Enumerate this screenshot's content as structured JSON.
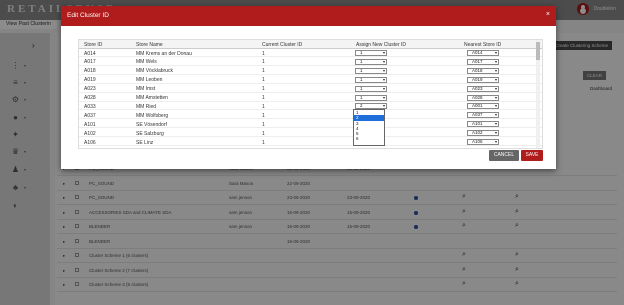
{
  "app": {
    "logo": "RETAILSENSE",
    "breadcrumb": "View Past Clusterin",
    "user": "Doublelon"
  },
  "sidebar": {
    "toggle": "›",
    "icons": [
      "network-icon",
      "layers-icon",
      "settings-icon",
      "user-icon",
      "group-icon",
      "trophy-icon",
      "person-icon",
      "team-icon",
      "globe-icon"
    ]
  },
  "background": {
    "create_button": "Create Clustering Scheme",
    "clear_button": "CLEAR",
    "dashboard_label": "Dashboard",
    "rows": [
      {
        "name": "PC_SOUND",
        "owner": "Sara Mason",
        "date": "22-09-2020",
        "date2": "22-09-2020",
        "dot": false,
        "view": false
      },
      {
        "name": "PC_SOUND",
        "owner": "Sara Mason",
        "date": "22-09-2020",
        "date2": "",
        "dot": false,
        "view": false
      },
      {
        "name": "PC_SOUND",
        "owner": "sam jenson",
        "date": "23-09-2020",
        "date2": "23-09-2020",
        "dot": true,
        "view": true
      },
      {
        "name": "ACCESSORIES SDA and CLIMATE SDA",
        "owner": "sam jenson",
        "date": "15-09-2020",
        "date2": "15-09-2020",
        "dot": true,
        "view": true
      },
      {
        "name": "BLENDER",
        "owner": "sam jenson",
        "date": "15-09-2020",
        "date2": "15-09-2020",
        "dot": true,
        "view": true
      },
      {
        "name": "BLENDER",
        "owner": "",
        "date": "15-09-2020",
        "date2": "",
        "dot": false,
        "view": false
      },
      {
        "name": "Cluster Scheme 1 (6 clusters)",
        "owner": "",
        "date": "",
        "date2": "",
        "dot": false,
        "view": true
      },
      {
        "name": "Cluster Scheme 2 (7 clusters)",
        "owner": "",
        "date": "",
        "date2": "",
        "dot": false,
        "view": true
      },
      {
        "name": "Cluster Scheme 3 (5 clusters)",
        "owner": "",
        "date": "",
        "date2": "",
        "dot": false,
        "view": true
      }
    ]
  },
  "modal": {
    "title": "Edit Cluster ID",
    "close": "×",
    "columns": [
      "Store ID",
      "Store Name",
      "Current Cluster ID",
      "Assign New Cluster ID",
      "Nearest Store ID"
    ],
    "rows": [
      {
        "store_id": "A014",
        "store_name": "MM Krems an der Donau",
        "current": "1",
        "assign": "1",
        "nearest": "A014"
      },
      {
        "store_id": "A017",
        "store_name": "MM Wels",
        "current": "1",
        "assign": "1",
        "nearest": "A017"
      },
      {
        "store_id": "A018",
        "store_name": "MM Vöcklabruck",
        "current": "1",
        "assign": "1",
        "nearest": "A018"
      },
      {
        "store_id": "A019",
        "store_name": "MM Leoben",
        "current": "1",
        "assign": "1",
        "nearest": "A019"
      },
      {
        "store_id": "A023",
        "store_name": "MM Imst",
        "current": "1",
        "assign": "1",
        "nearest": "A023"
      },
      {
        "store_id": "A028",
        "store_name": "MM Amstetten",
        "current": "1",
        "assign": "1",
        "nearest": "A028"
      },
      {
        "store_id": "A033",
        "store_name": "MM Ried",
        "current": "1",
        "assign": "2",
        "nearest": "A001"
      },
      {
        "store_id": "A037",
        "store_name": "MM Wolfsberg",
        "current": "1",
        "assign": "",
        "nearest": "A037"
      },
      {
        "store_id": "A101",
        "store_name": "SE Vösendorf",
        "current": "1",
        "assign": "",
        "nearest": "A101"
      },
      {
        "store_id": "A102",
        "store_name": "SE Salzburg",
        "current": "1",
        "assign": "",
        "nearest": "A102"
      },
      {
        "store_id": "A106",
        "store_name": "SE Linz",
        "current": "1",
        "assign": "",
        "nearest": "A106"
      }
    ],
    "dropdown_options": [
      "1",
      "2",
      "3",
      "4",
      "5",
      "6"
    ],
    "dropdown_selected": "2",
    "cancel_label": "CANCEL",
    "save_label": "SAVE"
  },
  "colors": {
    "brand_red": "#b01c1c",
    "topbar": "#8a8a8a",
    "highlight": "#1e6fd9"
  }
}
